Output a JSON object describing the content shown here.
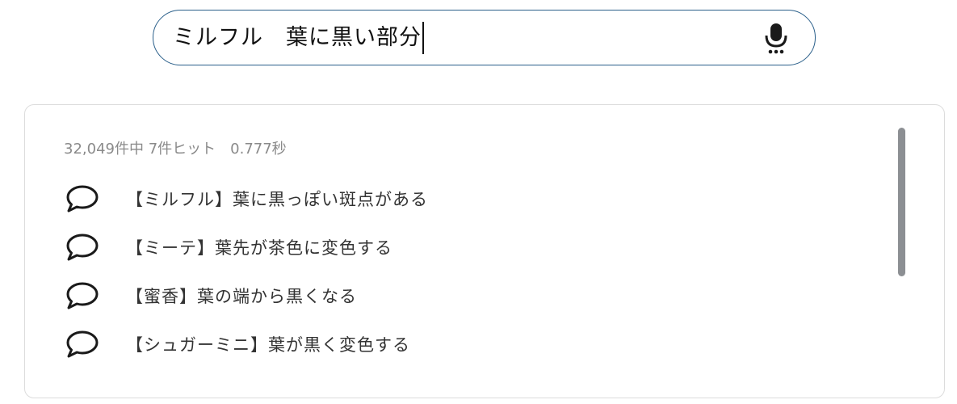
{
  "search": {
    "query": "ミルフル　葉に黒い部分",
    "mic_icon": "microphone-icon",
    "border_color": "#2a5f8a"
  },
  "results_panel": {
    "status": "32,049件中 7件ヒット　0.777秒",
    "item_icon": "speech-bubble-icon",
    "items": [
      {
        "label": "【ミルフル】葉に黒っぽい斑点がある"
      },
      {
        "label": "【ミーテ】葉先が茶色に変色する"
      },
      {
        "label": "【蜜香】葉の端から黒くなる"
      },
      {
        "label": "【シュガーミニ】葉が黒く変色する"
      }
    ],
    "scrollbar_color": "#8c8f93"
  }
}
